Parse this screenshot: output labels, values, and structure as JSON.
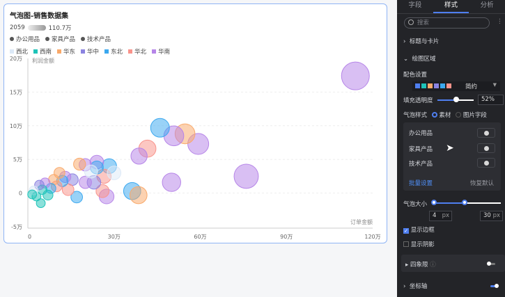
{
  "card": {
    "title": "气泡图-销售数据集",
    "size_min": "2059",
    "size_max": "110.7万",
    "categories": [
      "办公用品",
      "家具产品",
      "技术产品"
    ],
    "regions": [
      {
        "name": "西北",
        "color": "#dce9f7"
      },
      {
        "name": "西南",
        "color": "#1ec3b8"
      },
      {
        "name": "华东",
        "color": "#f9a96a"
      },
      {
        "name": "华中",
        "color": "#8b83e0"
      },
      {
        "name": "东北",
        "color": "#3ba8ef"
      },
      {
        "name": "华北",
        "color": "#f9938b"
      },
      {
        "name": "华南",
        "color": "#b685e8"
      }
    ]
  },
  "chart_data": {
    "type": "scatter",
    "xlabel": "订单金额",
    "ylabel": "利润金额",
    "xlim": [
      0,
      120
    ],
    "ylim": [
      -5,
      20
    ],
    "x_ticks": [
      "0",
      "30万",
      "60万",
      "90万",
      "120万"
    ],
    "y_ticks": [
      "20万",
      "15万",
      "10万",
      "5万",
      "0",
      "-5万"
    ],
    "points": [
      {
        "x": 114,
        "y": 17.4,
        "s": 100,
        "r": 6
      },
      {
        "x": 76,
        "y": 2.5,
        "s": 72,
        "r": 6
      },
      {
        "x": 59.3,
        "y": 7.3,
        "s": 50,
        "r": 6
      },
      {
        "x": 54.7,
        "y": 8.8,
        "s": 44,
        "r": 2
      },
      {
        "x": 50.8,
        "y": 8.5,
        "s": 44,
        "r": 6
      },
      {
        "x": 46,
        "y": 9.7,
        "s": 38,
        "r": 4
      },
      {
        "x": 41.6,
        "y": 6.6,
        "s": 30,
        "r": 5
      },
      {
        "x": 38.7,
        "y": 5.5,
        "s": 26,
        "r": 6
      },
      {
        "x": 50,
        "y": 1.6,
        "s": 36,
        "r": 6
      },
      {
        "x": 36.3,
        "y": 0.3,
        "s": 30,
        "r": 4
      },
      {
        "x": 38.5,
        "y": -0.3,
        "s": 30,
        "r": 2
      },
      {
        "x": 28.3,
        "y": 4,
        "s": 20,
        "r": 4
      },
      {
        "x": 27.4,
        "y": -0.5,
        "s": 20,
        "r": 6
      },
      {
        "x": 24,
        "y": 4.6,
        "s": 16,
        "r": 6
      },
      {
        "x": 26.5,
        "y": 2.5,
        "s": 18,
        "r": 5
      },
      {
        "x": 24,
        "y": 3.8,
        "s": 14,
        "r": 4
      },
      {
        "x": 26,
        "y": 0.3,
        "s": 14,
        "r": 5
      },
      {
        "x": 23,
        "y": 1.6,
        "s": 16,
        "r": 3
      },
      {
        "x": 20,
        "y": 4.2,
        "s": 12,
        "r": 6
      },
      {
        "x": 18,
        "y": 4.3,
        "s": 11,
        "r": 2
      },
      {
        "x": 20,
        "y": 1.6,
        "s": 12,
        "r": 6
      },
      {
        "x": 17,
        "y": -0.6,
        "s": 10,
        "r": 4
      },
      {
        "x": 15.5,
        "y": 2,
        "s": 10,
        "r": 3
      },
      {
        "x": 14,
        "y": 0.5,
        "s": 10,
        "r": 5
      },
      {
        "x": 13,
        "y": 2.4,
        "s": 9,
        "r": 6
      },
      {
        "x": 12,
        "y": 1.8,
        "s": 9,
        "r": 4
      },
      {
        "x": 11,
        "y": 3,
        "s": 8,
        "r": 2
      },
      {
        "x": 10,
        "y": 1,
        "s": 8,
        "r": 5
      },
      {
        "x": 9,
        "y": 2,
        "s": 7,
        "r": 2
      },
      {
        "x": 8,
        "y": 0.7,
        "s": 6,
        "r": 4
      },
      {
        "x": 7,
        "y": -0.3,
        "s": 6,
        "r": 1
      },
      {
        "x": 6,
        "y": 1.5,
        "s": 6,
        "r": 6
      },
      {
        "x": 5,
        "y": 0.5,
        "s": 5,
        "r": 1
      },
      {
        "x": 4.5,
        "y": -1.5,
        "s": 4,
        "r": 1
      },
      {
        "x": 4,
        "y": 1.2,
        "s": 5,
        "r": 3
      },
      {
        "x": 3,
        "y": -0.5,
        "s": 4,
        "r": 1
      },
      {
        "x": 2,
        "y": 0.4,
        "s": 4,
        "r": 0
      },
      {
        "x": 1.5,
        "y": -0.2,
        "s": 4,
        "r": 1
      },
      {
        "x": 22,
        "y": 3.2,
        "s": 14,
        "r": 0
      },
      {
        "x": 30,
        "y": 3,
        "s": 16,
        "r": 0
      }
    ]
  },
  "panel": {
    "tabs": [
      "字段",
      "样式",
      "分析"
    ],
    "search_placeholder": "搜索",
    "sec1": "标题与卡片",
    "sec2": "绘图区域",
    "color_label": "配色设置",
    "palette_name": "简约",
    "palette": [
      "#4f7ff0",
      "#1ec3b8",
      "#f9a96a",
      "#8b83e0",
      "#3ba8ef",
      "#f9938b"
    ],
    "opacity_label": "填充透明度",
    "opacity_value": "52%",
    "opacity": 0.52,
    "bubble_style_label": "气泡样式",
    "opt_material": "素材",
    "opt_image": "图片字段",
    "items": [
      "办公用品",
      "家具产品",
      "技术产品"
    ],
    "batch": "批量设置",
    "reset": "恢复默认",
    "size_label": "气泡大小",
    "size_min": "4",
    "size_max": "30",
    "px": "px",
    "show_border": "显示边框",
    "show_shadow": "显示阴影",
    "quadrant": "四象限",
    "axis": "坐标轴"
  }
}
